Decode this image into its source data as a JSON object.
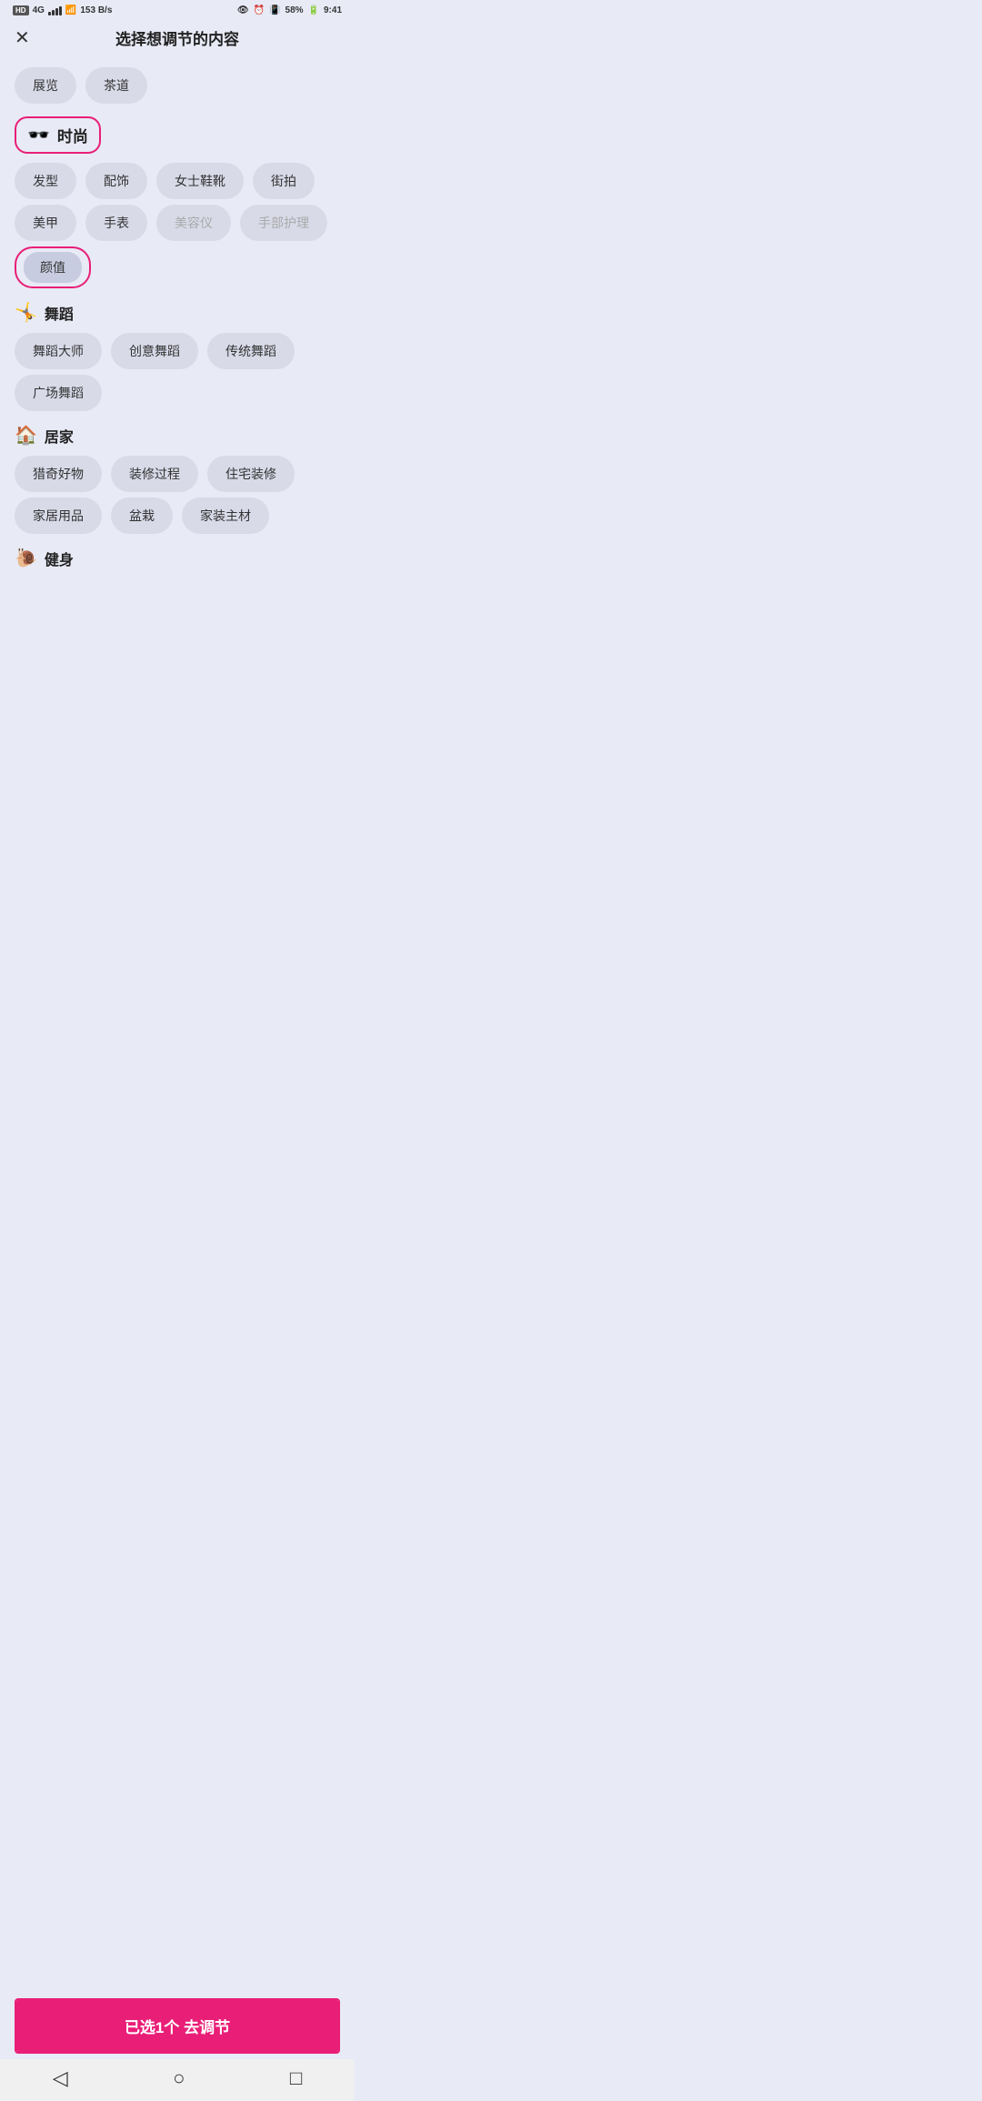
{
  "statusBar": {
    "hd": "HD",
    "signal4g": "4G",
    "speed": "153 B/s",
    "battery": "58%",
    "time": "9:41"
  },
  "header": {
    "close_label": "✕",
    "title": "选择想调节的内容"
  },
  "topTags": [
    "展览",
    "茶道"
  ],
  "sections": [
    {
      "id": "fashion",
      "icon": "🕶️",
      "label": "时尚",
      "selected": true,
      "tags": [
        {
          "label": "发型",
          "disabled": false
        },
        {
          "label": "配饰",
          "disabled": false
        },
        {
          "label": "女士鞋靴",
          "disabled": false
        },
        {
          "label": "街拍",
          "disabled": false
        },
        {
          "label": "美甲",
          "disabled": false
        },
        {
          "label": "手表",
          "disabled": false
        },
        {
          "label": "美容仪",
          "disabled": true
        },
        {
          "label": "手部护理",
          "disabled": true
        }
      ],
      "selectedTag": "颜值"
    },
    {
      "id": "dance",
      "icon": "🤸",
      "label": "舞蹈",
      "selected": false,
      "tags": [
        {
          "label": "舞蹈大师",
          "disabled": false
        },
        {
          "label": "创意舞蹈",
          "disabled": false
        },
        {
          "label": "传统舞蹈",
          "disabled": false
        },
        {
          "label": "广场舞蹈",
          "disabled": false
        }
      ]
    },
    {
      "id": "home",
      "icon": "🏠",
      "label": "居家",
      "selected": false,
      "tags": [
        {
          "label": "猎奇好物",
          "disabled": false
        },
        {
          "label": "装修过程",
          "disabled": false
        },
        {
          "label": "住宅装修",
          "disabled": false
        },
        {
          "label": "家居用品",
          "disabled": false
        },
        {
          "label": "盆栽",
          "disabled": false
        },
        {
          "label": "家装主材",
          "disabled": false
        }
      ]
    },
    {
      "id": "fitness",
      "icon": "🐌",
      "label": "健身",
      "selected": false,
      "tags": []
    }
  ],
  "actionButton": {
    "label": "已选1个 去调节"
  },
  "nav": {
    "back": "◁",
    "home": "○",
    "square": "□"
  }
}
